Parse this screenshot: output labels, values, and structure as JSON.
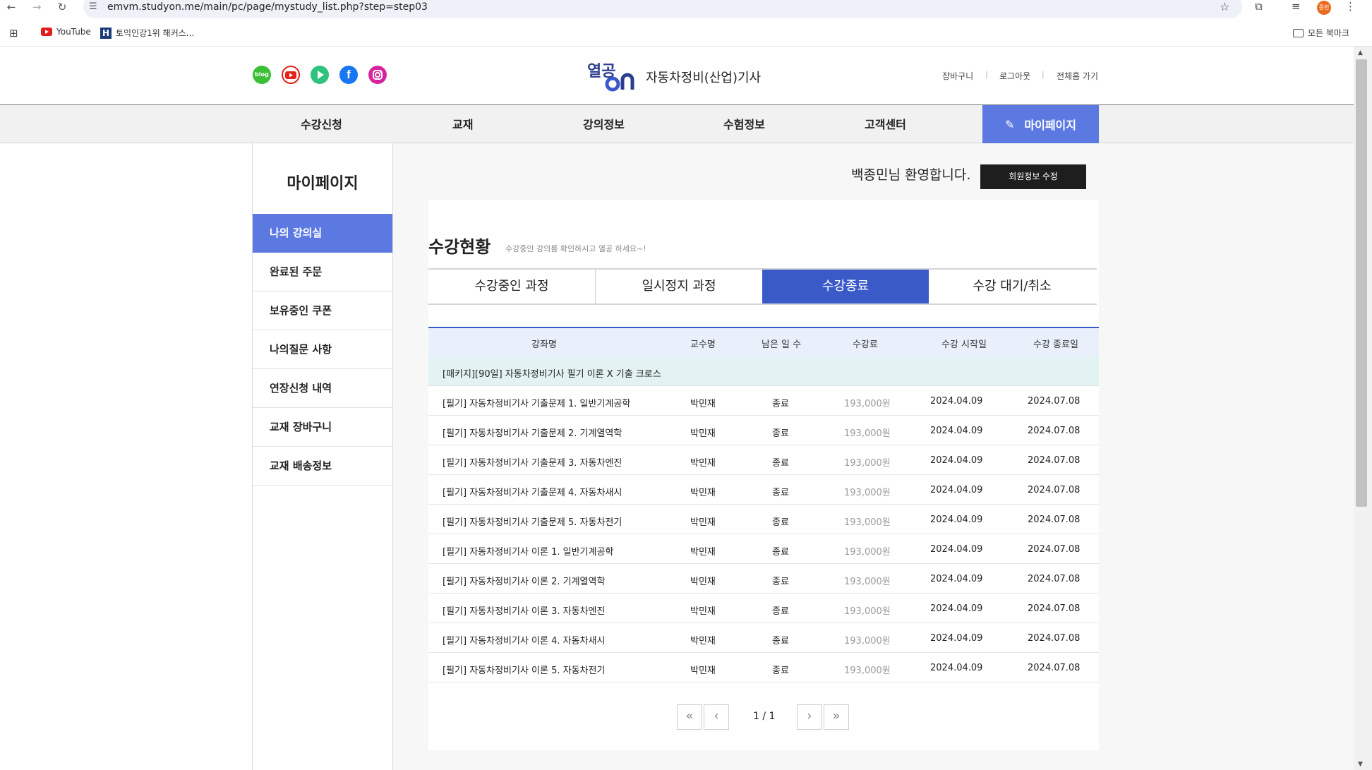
{
  "browser": {
    "url": "emvm.studyon.me/main/pc/page/mystudy_list.php?step=step03",
    "avatar_label": "종민",
    "bookmarks": [
      {
        "label": "YouTube"
      },
      {
        "label": "토익인강1위 해커스..."
      }
    ],
    "all_bookmarks_label": "모든 북마크"
  },
  "header": {
    "social": [
      "blog",
      "youtube",
      "play",
      "facebook",
      "instagram"
    ],
    "social_blog_label": "blog",
    "site_title": "자동차정비(산업)기사",
    "links": [
      "장바구니",
      "로그아웃",
      "전체홈 가기"
    ]
  },
  "nav": {
    "items": [
      "수강신청",
      "교재",
      "강의정보",
      "수험정보",
      "고객센터"
    ],
    "mypage": "마이페이지"
  },
  "sidebar": {
    "title": "마이페이지",
    "items": [
      "나의 강의실",
      "완료된 주문",
      "보유중인 쿠폰",
      "나의질문 사항",
      "연장신청 내역",
      "교재 장바구니",
      "교재 배송정보"
    ]
  },
  "main": {
    "welcome": "백종민님 환영합니다.",
    "edit_button": "회원정보 수정",
    "title": "수강현황",
    "subtitle": "수강중인 강의를 확인하시고 열공 하세요~!",
    "tabs": [
      "수강중인 과정",
      "일시정지 과정",
      "수강종료",
      "수강 대기/취소"
    ],
    "table": {
      "headers": [
        "강좌명",
        "교수명",
        "남은 일 수",
        "수강료",
        "수강 시작일",
        "수강 종료일"
      ],
      "package": "[패키지][90일] 자동차정비기사 필기 이론 X 기출 크로스",
      "rows": [
        {
          "name": "[필기] 자동차정비기사 기출문제 1. 일반기계공학",
          "prof": "박민재",
          "remain": "종료",
          "fee": "193,000원",
          "start": "2024.04.09",
          "end": "2024.07.08"
        },
        {
          "name": "[필기] 자동차정비기사 기출문제 2. 기계열역학",
          "prof": "박민재",
          "remain": "종료",
          "fee": "193,000원",
          "start": "2024.04.09",
          "end": "2024.07.08"
        },
        {
          "name": "[필기] 자동차정비기사 기출문제 3. 자동차엔진",
          "prof": "박민재",
          "remain": "종료",
          "fee": "193,000원",
          "start": "2024.04.09",
          "end": "2024.07.08"
        },
        {
          "name": "[필기] 자동차정비기사 기출문제 4. 자동차새시",
          "prof": "박민재",
          "remain": "종료",
          "fee": "193,000원",
          "start": "2024.04.09",
          "end": "2024.07.08"
        },
        {
          "name": "[필기] 자동차정비기사 기출문제 5. 자동차전기",
          "prof": "박민재",
          "remain": "종료",
          "fee": "193,000원",
          "start": "2024.04.09",
          "end": "2024.07.08"
        },
        {
          "name": "[필기] 자동차정비기사 이론 1. 일반기계공학",
          "prof": "박민재",
          "remain": "종료",
          "fee": "193,000원",
          "start": "2024.04.09",
          "end": "2024.07.08"
        },
        {
          "name": "[필기] 자동차정비기사 이론 2. 기계열역학",
          "prof": "박민재",
          "remain": "종료",
          "fee": "193,000원",
          "start": "2024.04.09",
          "end": "2024.07.08"
        },
        {
          "name": "[필기] 자동차정비기사 이론 3. 자동차엔진",
          "prof": "박민재",
          "remain": "종료",
          "fee": "193,000원",
          "start": "2024.04.09",
          "end": "2024.07.08"
        },
        {
          "name": "[필기] 자동차정비기사 이론 4. 자동차새시",
          "prof": "박민재",
          "remain": "종료",
          "fee": "193,000원",
          "start": "2024.04.09",
          "end": "2024.07.08"
        },
        {
          "name": "[필기] 자동차정비기사 이론 5. 자동차전기",
          "prof": "박민재",
          "remain": "종료",
          "fee": "193,000원",
          "start": "2024.04.09",
          "end": "2024.07.08"
        }
      ]
    },
    "pagination": "1 / 1"
  },
  "colors": {
    "accent": "#5b79e0",
    "tab_active": "#3a5ac8",
    "header_bg": "#e9f0fb",
    "package_bg": "#e3f2f2"
  }
}
